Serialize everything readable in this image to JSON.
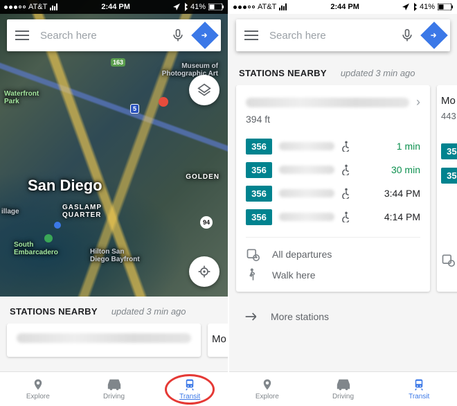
{
  "status": {
    "carrier": "AT&T",
    "time": "2:44 PM",
    "battery": "41%",
    "bt_glyph": "*"
  },
  "search": {
    "placeholder": "Search here"
  },
  "map": {
    "city": "San Diego",
    "gaslamp": "GASLAMP\nQUARTER",
    "golden": "GOLDEN",
    "village": "illage",
    "waterfront": "Waterfront\nPark",
    "south_emb": "South\nEmbarcadero",
    "hilton": "Hilton San\nDiego Bayfront",
    "museum": "Museum of\nPhotographic Art",
    "shield_5": "5",
    "shield_94": "94",
    "shield_163": "163"
  },
  "panel": {
    "title": "STATIONS NEARBY",
    "updated": "updated 3 min ago",
    "station": {
      "distance": "394 ft",
      "peek_name": "Mo",
      "peek_dist": "443",
      "departures": [
        {
          "route": "356",
          "eta": "1 min",
          "soon": true
        },
        {
          "route": "356",
          "eta": "30 min",
          "soon": true
        },
        {
          "route": "356",
          "eta": "3:44 PM",
          "soon": false
        },
        {
          "route": "356",
          "eta": "4:14 PM",
          "soon": false
        }
      ],
      "all_dep": "All departures",
      "walk": "Walk here"
    },
    "more": "More stations"
  },
  "nav": {
    "explore": "Explore",
    "driving": "Driving",
    "transit": "Transit"
  }
}
